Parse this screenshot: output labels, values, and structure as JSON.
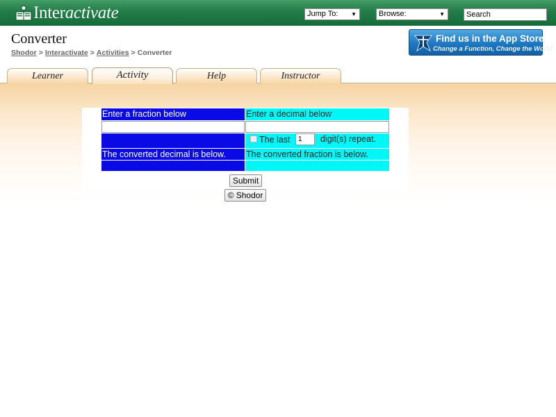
{
  "site": {
    "logo_text_bold": "Inter",
    "logo_text_italic": "activate",
    "colors": {
      "banner": "#1f7a45",
      "tab": "#fbe6c8",
      "blue_cell": "#0a0ae6",
      "cyan_cell": "#00f7f7",
      "appstore": "#1e78c2"
    }
  },
  "nav": {
    "jump_to": "Jump To:",
    "browse": "Browse:",
    "search_value": "Search"
  },
  "header": {
    "title": "Converter",
    "breadcrumb": [
      "Shodor",
      "Interactivate",
      "Activities",
      "Converter"
    ],
    "breadcrumb_sep": ">",
    "appstore_line1": "Find us in the App Store.",
    "appstore_line2": "Change a Function, Change the World"
  },
  "tabs": [
    {
      "label": "Learner",
      "active": false
    },
    {
      "label": "Activity",
      "active": true
    },
    {
      "label": "Help",
      "active": false
    },
    {
      "label": "Instructor",
      "active": false
    }
  ],
  "converter": {
    "fraction_prompt": "Enter a fraction below",
    "decimal_prompt": "Enter a decimal below",
    "fraction_input_value": "",
    "decimal_input_value": "",
    "repeat_checkbox_checked": false,
    "repeat_label_before": "The last",
    "repeat_digits_value": "1",
    "repeat_label_after": "digit(s) repeat.",
    "decimal_result_label": "The converted decimal is below.",
    "fraction_result_label": "The converted fraction is below.",
    "decimal_result": "",
    "fraction_result": "",
    "submit_label": "Submit",
    "copyright_label": "© Shodor"
  }
}
